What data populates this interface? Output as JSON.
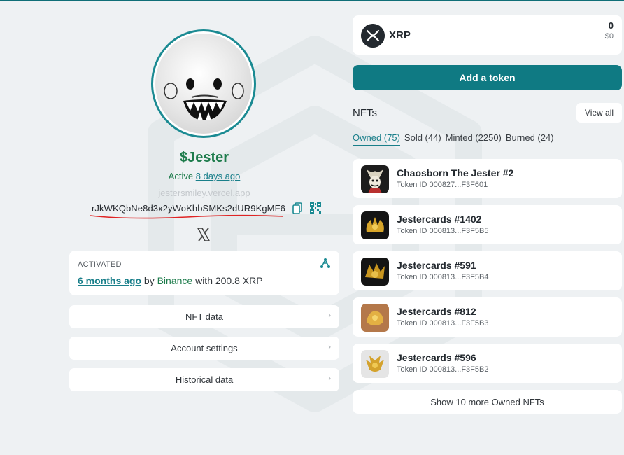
{
  "profile": {
    "name": "$Jester",
    "status_word": "Active",
    "status_ago": "8 days ago",
    "domain": "jestersmiley.vercel.app",
    "address": "rJkWKQbNe8d3x2yWoKhbSMKs2dUR9KgMF6"
  },
  "activated": {
    "label": "ACTIVATED",
    "date": "6 months ago",
    "by_word": "by",
    "by_name": "Binance",
    "with_text": "with 200.8 XRP"
  },
  "accordion": [
    {
      "label": "NFT data"
    },
    {
      "label": "Account settings"
    },
    {
      "label": "Historical data"
    }
  ],
  "balance": {
    "currency": "XRP",
    "amount": "0",
    "usd": "$0"
  },
  "add_token_label": "Add a token",
  "nfts": {
    "title": "NFTs",
    "view_all": "View all",
    "tabs": [
      {
        "label": "Owned (75)",
        "active": true
      },
      {
        "label": "Sold (44)",
        "active": false
      },
      {
        "label": "Minted (2250)",
        "active": false
      },
      {
        "label": "Burned (24)",
        "active": false
      }
    ],
    "items": [
      {
        "name": "Chaosborn The Jester #2",
        "token": "Token ID 000827...F3F601"
      },
      {
        "name": "Jestercards #1402",
        "token": "Token ID 000813...F3F5B5"
      },
      {
        "name": "Jestercards #591",
        "token": "Token ID 000813...F3F5B4"
      },
      {
        "name": "Jestercards #812",
        "token": "Token ID 000813...F3F5B3"
      },
      {
        "name": "Jestercards #596",
        "token": "Token ID 000813...F3F5B2"
      }
    ],
    "show_more": "Show 10 more Owned NFTs"
  },
  "colors": {
    "accent": "#0f7a83",
    "green": "#1e7c4c",
    "background": "#eef1f3"
  }
}
